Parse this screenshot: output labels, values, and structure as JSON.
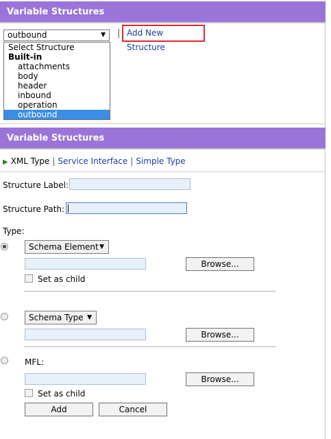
{
  "top_panel": {
    "title": "Variable Structures",
    "select_value": "outbound",
    "add_new_label": "Add New Structure",
    "dropdown": {
      "options": [
        {
          "label": "Select Structure",
          "kind": "option"
        },
        {
          "label": "Built-in",
          "kind": "group"
        },
        {
          "label": "attachments",
          "kind": "sub"
        },
        {
          "label": "body",
          "kind": "sub"
        },
        {
          "label": "header",
          "kind": "sub"
        },
        {
          "label": "inbound",
          "kind": "sub"
        },
        {
          "label": "operation",
          "kind": "sub"
        },
        {
          "label": "outbound",
          "kind": "sub",
          "selected": true
        }
      ]
    }
  },
  "bottom_panel": {
    "title": "Variable Structures",
    "tabs": [
      "XML Type",
      "Service Interface",
      "Simple Type"
    ],
    "form": {
      "structure_label": "Structure Label:",
      "structure_path": "Structure Path:",
      "type_label": "Type:",
      "schema_element": "Schema Element",
      "schema_type": "Schema Type",
      "mfl": "MFL:",
      "browse": "Browse...",
      "set_as_child": "Set as child",
      "add": "Add",
      "cancel": "Cancel"
    }
  },
  "colors": {
    "header_bg": "#9b74d9",
    "link": "#1a3fa0",
    "highlight_border": "#e2252b",
    "selected_option": "#3a8ee6"
  }
}
